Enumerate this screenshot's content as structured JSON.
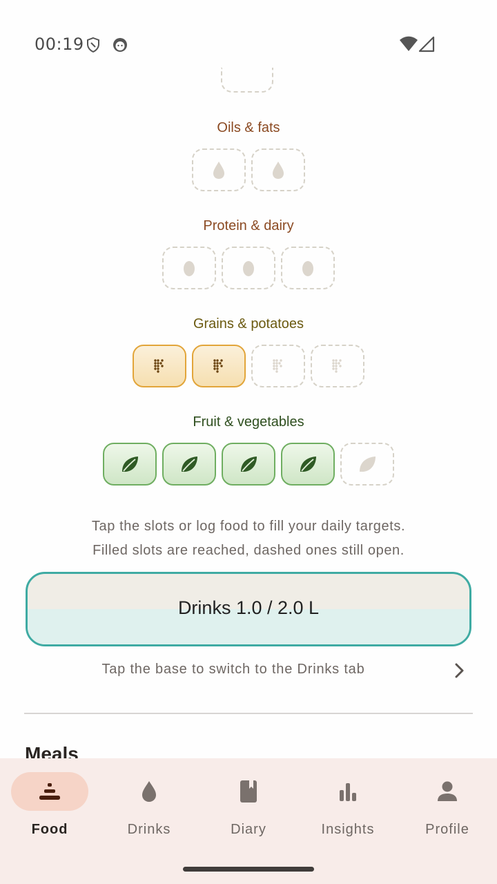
{
  "status_bar": {
    "time": "00:19"
  },
  "pyramid": {
    "tiers": [
      {
        "label": "Oils & fats",
        "color": "#8b4a22",
        "icon": "drop-icon",
        "filled": 0,
        "total": 2
      },
      {
        "label": "Protein & dairy",
        "color": "#8b4a22",
        "icon": "egg-icon",
        "filled": 0,
        "total": 3
      },
      {
        "label": "Grains & potatoes",
        "color": "#6b5a10",
        "icon": "grain-icon",
        "filled": 2,
        "total": 4
      },
      {
        "label": "Fruit & vegetables",
        "color": "#2f4f1f",
        "icon": "leaf-icon",
        "filled": 4,
        "total": 5
      }
    ]
  },
  "help": {
    "line1": "Tap the slots or log food to fill your daily targets.",
    "line2": "Filled slots are reached, dashed ones still open."
  },
  "drinks": {
    "label": "Drinks 1.0 / 2.0 L",
    "fill_fraction": 0.5,
    "accent": "#3faba3"
  },
  "switch_hint": "Tap the base to switch to the Drinks tab",
  "meals_heading": "Meals",
  "nav": {
    "items": [
      {
        "label": "Food",
        "icon": "pyramid-icon",
        "active": true
      },
      {
        "label": "Drinks",
        "icon": "drop-icon",
        "active": false
      },
      {
        "label": "Diary",
        "icon": "book-icon",
        "active": false
      },
      {
        "label": "Insights",
        "icon": "bar-chart-icon",
        "active": false
      },
      {
        "label": "Profile",
        "icon": "person-icon",
        "active": false
      }
    ]
  }
}
